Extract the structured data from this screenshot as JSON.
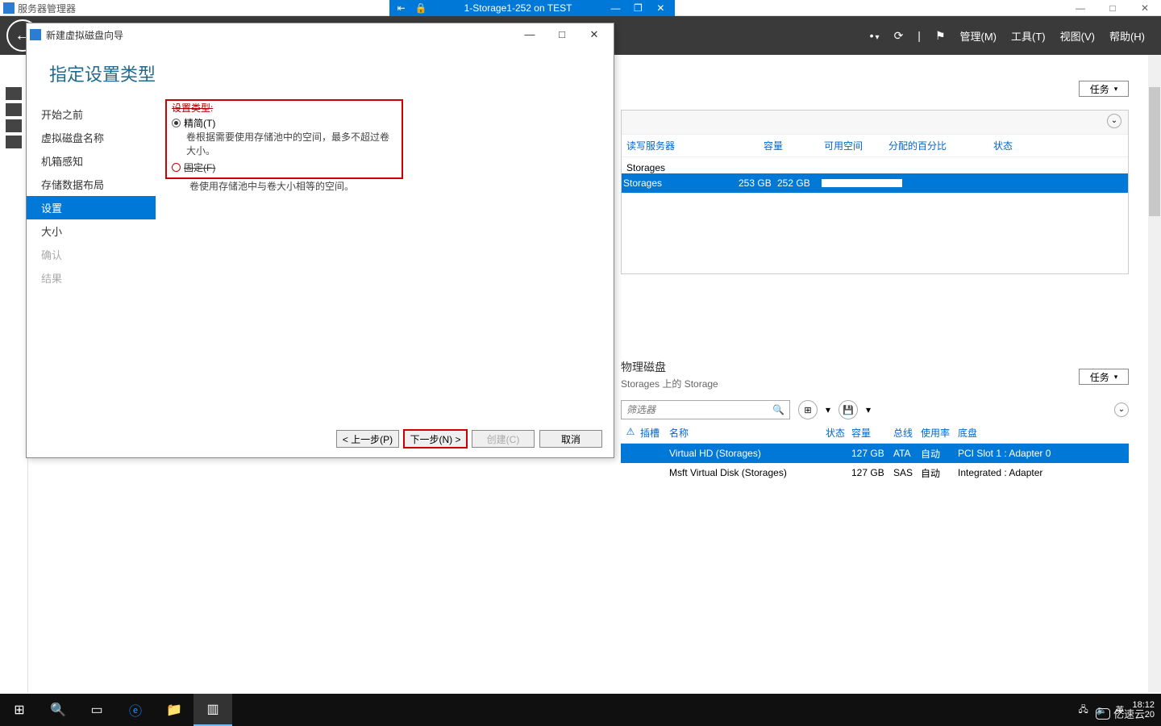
{
  "vm_window": {
    "title": "1-Storage1-252 on TEST",
    "pin_icon": "⇤",
    "lock_icon": "🔒",
    "min": "—",
    "restore": "❐",
    "close": "✕",
    "outer_min": "—",
    "outer_restore": "□",
    "outer_close": "✕"
  },
  "server_manager": {
    "title": "服务器管理器",
    "menu": {
      "manage": "管理(M)",
      "tools": "工具(T)",
      "view": "视图(V)",
      "help": "帮助(H)"
    },
    "tasks_label": "任务"
  },
  "storage_pool": {
    "col_rw": "读写服务器",
    "col_capacity": "容量",
    "col_free": "可用空间",
    "col_pct": "分配的百分比",
    "col_status": "状态",
    "group_name": "Storages",
    "row": {
      "name": "Storages",
      "capacity": "253 GB",
      "free": "252 GB"
    }
  },
  "physical_disk": {
    "title": "物理磁盘",
    "subtitle": "Storages 上的 Storage",
    "filter_placeholder": "筛选器",
    "cols": {
      "warn": "⚠",
      "slot": "插槽",
      "name": "名称",
      "status": "状态",
      "capacity": "容量",
      "bus": "总线",
      "usage": "使用率",
      "chassis": "底盘"
    },
    "rows": [
      {
        "name": "Virtual HD (Storages)",
        "capacity": "127 GB",
        "bus": "ATA",
        "usage": "自动",
        "chassis": "PCI Slot 1 : Adapter 0"
      },
      {
        "name": "Msft Virtual Disk (Storages)",
        "capacity": "127 GB",
        "bus": "SAS",
        "usage": "自动",
        "chassis": "Integrated : Adapter"
      }
    ]
  },
  "wizard": {
    "title": "新建虚拟磁盘向导",
    "heading": "指定设置类型",
    "nav": {
      "before": "开始之前",
      "disk_name": "虚拟磁盘名称",
      "enclosure": "机箱感知",
      "layout": "存储数据布局",
      "settings": "设置",
      "size": "大小",
      "confirm": "确认",
      "result": "结果"
    },
    "content": {
      "section_label": "设置类型:",
      "thin": "精简(T)",
      "thin_desc": "卷根据需要使用存储池中的空间，最多不超过卷大小。",
      "fixed": "固定(F)",
      "fixed_desc": "卷使用存储池中与卷大小相等的空间。"
    },
    "buttons": {
      "prev": "< 上一步(P)",
      "next": "下一步(N) >",
      "create": "创建(C)",
      "cancel": "取消"
    },
    "ctrls": {
      "min": "—",
      "max": "□",
      "close": "✕"
    }
  },
  "taskbar": {
    "time": "18:12",
    "date_partial": "20",
    "ime": "英"
  },
  "watermark": "亿速云"
}
